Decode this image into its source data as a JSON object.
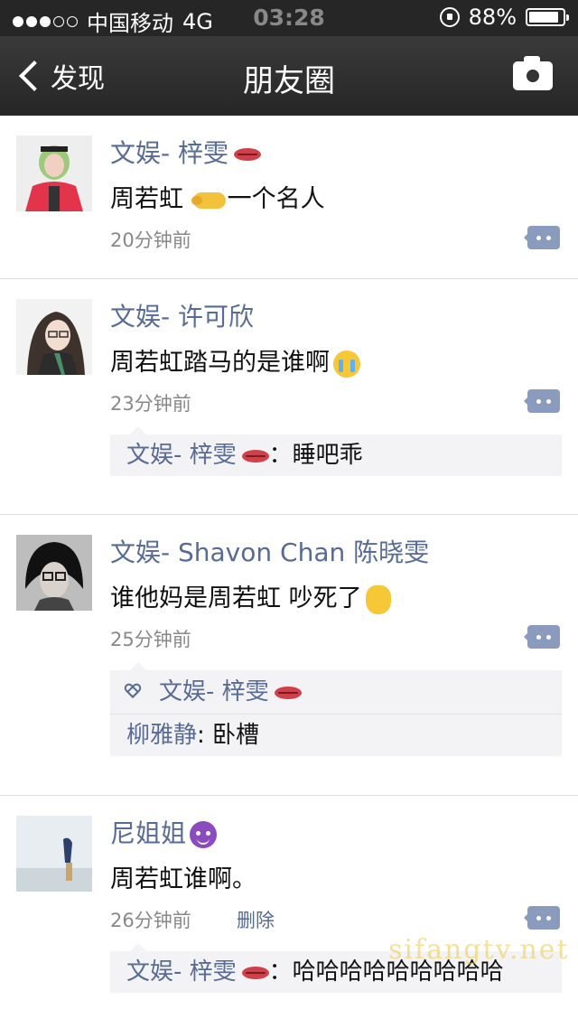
{
  "status_bar": {
    "carrier": "中国移动",
    "network": "4G",
    "time": "03:28",
    "battery": "88%",
    "battery_level": 0.88,
    "signal_dots": 3
  },
  "nav": {
    "back_label": "发现",
    "title": "朋友圈"
  },
  "posts": [
    {
      "nickname": "文娱- 梓雯",
      "nick_emoji": "lips-icon",
      "text_a": "周若虹 ",
      "text_emoji": "pointing-finger-icon",
      "text_b": "一个名人",
      "time": "20分钟前"
    },
    {
      "nickname": "文娱- 许可欣",
      "text": "周若虹踏马的是谁啊",
      "text_emoji": "crying-face-icon",
      "time": "23分钟前",
      "comments": [
        {
          "name": "文娱- 梓雯",
          "name_emoji": "lips-icon",
          "text": "：睡吧乖"
        }
      ]
    },
    {
      "nickname": "文娱- Shavon Chan 陈晓雯",
      "text": "谁他妈是周若虹 吵死了",
      "text_emoji": "waving-hand-icon",
      "time": "25分钟前",
      "likes": {
        "names": "文娱- 梓雯",
        "name_emoji": "lips-icon"
      },
      "comments": [
        {
          "name": "柳雅静",
          "text": ": 卧槽"
        }
      ]
    },
    {
      "nickname": "尼姐姐",
      "nick_emoji": "devil-face-icon",
      "text": "周若虹谁啊。",
      "time": "26分钟前",
      "delete_label": "删除",
      "comments": [
        {
          "name": "文娱- 梓雯",
          "name_emoji": "lips-icon",
          "text": "：哈哈哈哈哈哈哈哈哈"
        }
      ]
    }
  ],
  "watermark": "sifangtv.net",
  "colors": {
    "nick": "#576b95",
    "navbar": "#2e2e2e",
    "comment_bg": "#f3f3f5"
  }
}
